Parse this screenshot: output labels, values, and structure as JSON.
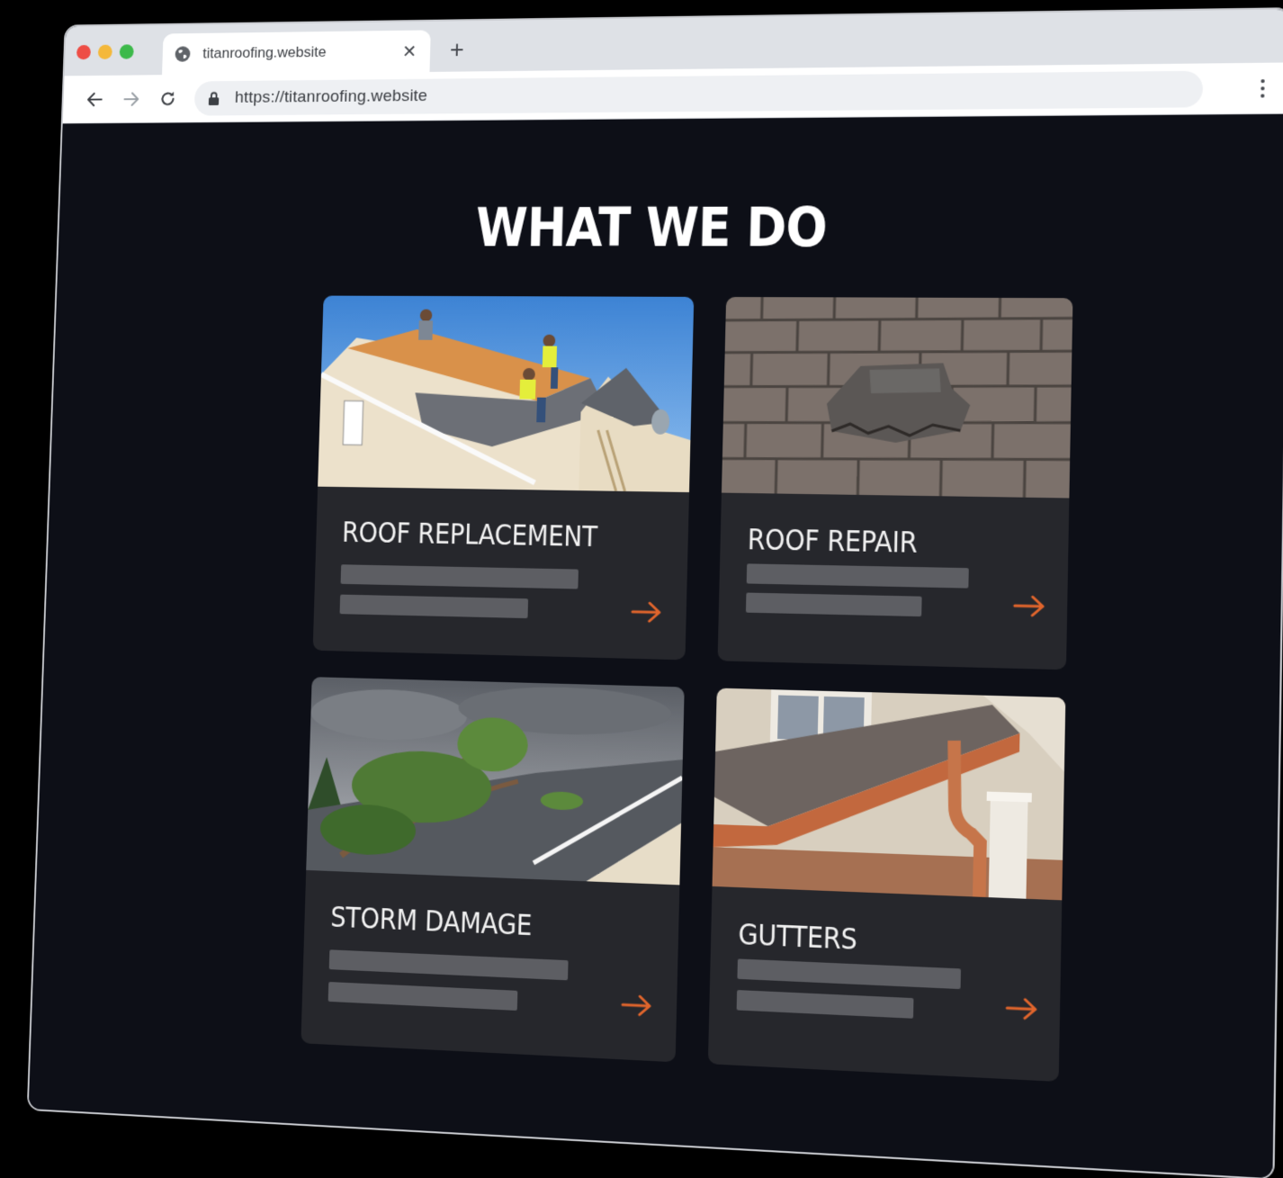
{
  "browser": {
    "tab_title": "titanroofing.website",
    "tab_close": "✕",
    "new_tab": "+",
    "url": "https://titanroofing.website"
  },
  "page": {
    "heading": "WHAT WE DO",
    "accent_color": "#e0652c",
    "services": [
      {
        "title": "ROOF REPLACEMENT",
        "image": "roofers-installing-shingles"
      },
      {
        "title": "ROOF REPAIR",
        "image": "damaged-shingles-closeup"
      },
      {
        "title": "STORM DAMAGE",
        "image": "fallen-tree-on-roof"
      },
      {
        "title": "GUTTERS",
        "image": "copper-gutter-downspout"
      }
    ]
  }
}
